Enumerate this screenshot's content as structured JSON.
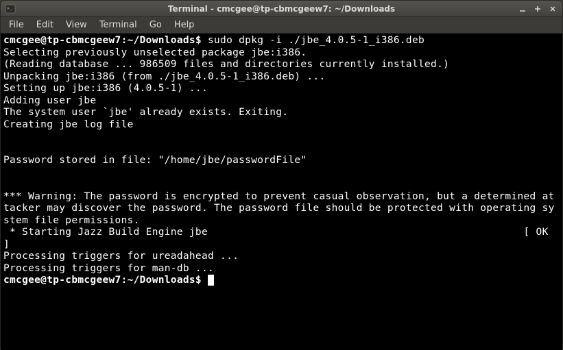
{
  "window": {
    "title": "Terminal - cmcgee@tp-cbmcgeew7: ~/Downloads"
  },
  "menu": {
    "items": [
      "File",
      "Edit",
      "View",
      "Terminal",
      "Go",
      "Help"
    ]
  },
  "terminal": {
    "prompt": "cmcgee@tp-cbmcgeew7:~/Downloads$",
    "command": "sudo dpkg -i ./jbe_4.0.5-1_i386.deb",
    "lines": [
      "Selecting previously unselected package jbe:i386.",
      "(Reading database ... 986509 files and directories currently installed.)",
      "Unpacking jbe:i386 (from ./jbe_4.0.5-1_i386.deb) ...",
      "Setting up jbe:i386 (4.0.5-1) ...",
      "Adding user jbe",
      "The system user `jbe' already exists. Exiting.",
      "Creating jbe log file",
      "",
      "",
      "Password stored in file: \"/home/jbe/passwordFile\"",
      "",
      "",
      "*** Warning: The password is encrypted to prevent casual observation, but a determined attacker may discover the password. The password file should be protected with operating system file permissions."
    ],
    "service_line": " * Starting Jazz Build Engine jbe",
    "service_status": "[ OK ]",
    "post_lines": [
      "Processing triggers for ureadahead ...",
      "Processing triggers for man-db ..."
    ]
  }
}
